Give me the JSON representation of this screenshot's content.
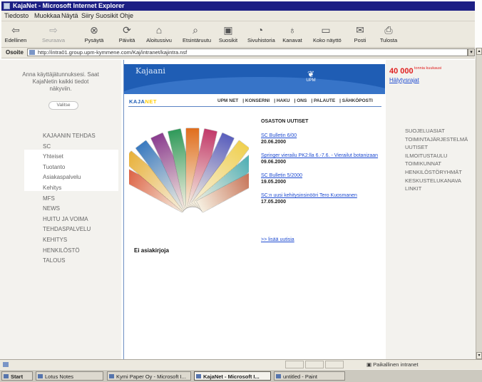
{
  "window": {
    "title": "KajaNet - Microsoft Internet Explorer"
  },
  "menu": {
    "items": [
      "Tiedosto",
      "Muokkaa",
      "Näytä",
      "Siiry",
      "Suosikit",
      "Ohje"
    ]
  },
  "toolbar": {
    "buttons": [
      {
        "label": "Edellinen",
        "icon": "back-arrow-icon"
      },
      {
        "label": "Seuraava",
        "icon": "forward-arrow-icon"
      },
      {
        "label": "Pysäytä",
        "icon": "stop-icon"
      },
      {
        "label": "Päivitä",
        "icon": "refresh-icon"
      },
      {
        "label": "Aloitussivu",
        "icon": "home-icon"
      },
      {
        "label": "Etsintäruutu",
        "icon": "search-icon"
      },
      {
        "label": "Suosikit",
        "icon": "favorites-icon"
      },
      {
        "label": "Sivuhistoria",
        "icon": "history-icon"
      },
      {
        "label": "Kanavat",
        "icon": "channels-icon"
      },
      {
        "label": "Koko näyttö",
        "icon": "fullscreen-icon"
      },
      {
        "label": "Posti",
        "icon": "mail-icon"
      },
      {
        "label": "Tulosta",
        "icon": "print-icon"
      }
    ]
  },
  "address": {
    "label": "Osoite",
    "url": "http://intra01.group.upm-kymmene.com/Kaj/intranet/kajintra.nsf"
  },
  "left": {
    "login_text": "Anna käyttäjätunnuksesi. Saat KajaNetin kaikki tiedot näkyviin.",
    "login_button": "Valitse",
    "nav": [
      "KAJAANIN TEHDAS",
      "SC",
      "Yhteiset",
      "Tuotanto",
      "Asiakaspalvelu",
      "Kehitys",
      "MFS",
      "NEWS",
      "HUITU JA VOIMA",
      "TEHDASPALVELU",
      "KEHITYS",
      "HENKILÖSTÖ",
      "TALOUS"
    ]
  },
  "center": {
    "brand": "Kajaani",
    "upm": "UPM",
    "logo_main": "KAJA",
    "logo_tail": "NET",
    "topnav": [
      "UPM NET",
      "KONSERNI",
      "HAKU",
      "ONS",
      "PALAUTE",
      "SÄHKÖPOSTI"
    ],
    "news_title": "OSASTON UUTISET",
    "news": [
      {
        "title": "SC Bulletin 6/00",
        "date": "20.06.2000"
      },
      {
        "title": "Springer vierailu PK2:lla 6.-7.6. - Vierailut botanizaan",
        "date": "09.06.2000"
      },
      {
        "title": "SC Bulletin 5/2000",
        "date": "19.05.2000"
      },
      {
        "title": "SC:n uusi kehitysinsinööri Tero Kuosmanen",
        "date": "17.05.2000"
      }
    ],
    "more": ">> lisää uutisia",
    "empty_docs": "Ei asiakirjoja",
    "magazine_colors": [
      "#d84a2a",
      "#e8b13a",
      "#3a7ac0",
      "#8a3d8f",
      "#2f9a5a",
      "#e06e1e",
      "#c23a6a",
      "#5a5fbd",
      "#f0d050",
      "#3aa7b0",
      "#b64a2a"
    ]
  },
  "right": {
    "counter": "40 000",
    "counter_sub": "tonnia kuukausi",
    "counter_link": "Hälytysrajat",
    "nav": [
      "SUOJELUASIAT",
      "TOIMINTAJÄRJESTELMÄ",
      "UUTISET",
      "ILMOITUSTAULU",
      "TOIMIKUNNAT",
      "HENKILÖSTÖRYHMÄT",
      "KESKUSTELUKANAVA",
      "LINKIT"
    ]
  },
  "status": {
    "zone": "Paikallinen intranet"
  },
  "taskbar": {
    "start": "Start",
    "tasks": [
      {
        "label": "Lotus Notes",
        "active": false
      },
      {
        "label": "Kymi Paper Oy - Microsoft I...",
        "active": false
      },
      {
        "label": "KajaNet - Microsoft I...",
        "active": true
      },
      {
        "label": "untitled - Paint",
        "active": false
      }
    ]
  }
}
